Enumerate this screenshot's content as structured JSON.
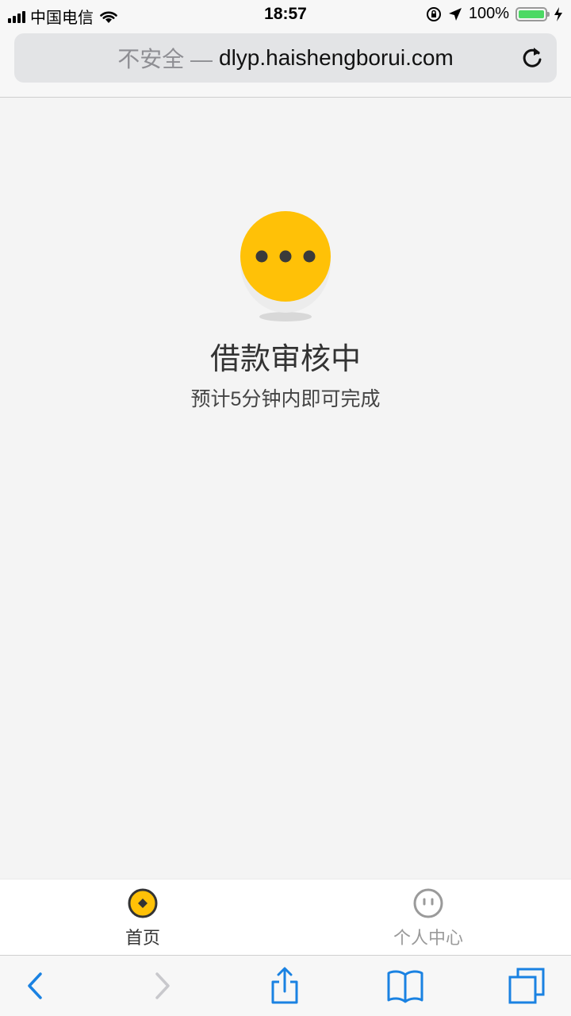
{
  "status_bar": {
    "carrier": "中国电信",
    "time": "18:57",
    "battery_percent": "100%",
    "battery_level": 1.0,
    "signal_icon": "signal-bars-icon",
    "wifi_icon": "wifi-icon",
    "lock_icon": "rotation-lock-icon",
    "location_icon": "location-arrow-icon",
    "charging_icon": "charging-bolt-icon"
  },
  "address_bar": {
    "security_label": "不安全 —",
    "url": "dlyp.haishengborui.com",
    "reload_icon": "reload-icon"
  },
  "main": {
    "status_icon": "pending-dots-icon",
    "title": "借款审核中",
    "subtitle": "预计5分钟内即可完成"
  },
  "tab_bar": {
    "tabs": [
      {
        "label": "首页",
        "icon": "coin-icon",
        "active": true
      },
      {
        "label": "个人中心",
        "icon": "face-icon",
        "active": false
      }
    ]
  },
  "toolbar": {
    "back_icon": "back-arrow-icon",
    "forward_icon": "forward-arrow-icon",
    "share_icon": "share-icon",
    "bookmarks_icon": "book-icon",
    "tabs_icon": "tabs-icon"
  },
  "colors": {
    "accent_yellow": "#FFC107",
    "link_blue": "#1A82E2",
    "background": "#F4F4F4"
  }
}
